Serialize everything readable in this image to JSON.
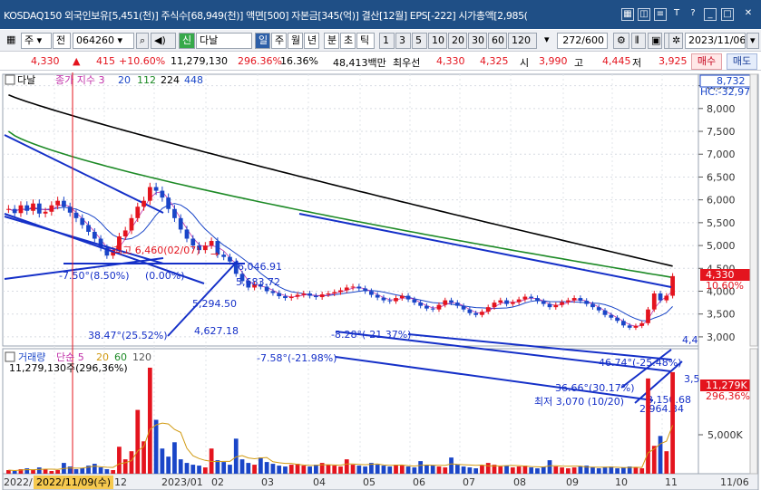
{
  "window": {
    "title": "KOSDAQ150 외국인보유[5,451(천)] 주식수[68,949(천)] 액면[500] 자본금[345(억)] 결산[12월] EPS[-222] 시가총액[2,985(",
    "icons": [
      "grid-icon",
      "save-icon",
      "list-icon",
      "text-icon",
      "help-icon",
      "minimize-icon",
      "maximize-icon",
      "close-icon"
    ],
    "close_glyph": "✕",
    "help_glyph": "?",
    "text_glyph": "T"
  },
  "toolbar": {
    "market_type": "주",
    "code_prefix": "전",
    "stock_code": "064260",
    "stock_badge": "신",
    "stock_name": "다날",
    "periods": [
      "일",
      "주",
      "월",
      "년",
      "분",
      "초",
      "틱"
    ],
    "minute_intervals": [
      "1",
      "3",
      "5",
      "10",
      "20",
      "30",
      "60",
      "120"
    ],
    "display_count": "272",
    "display_total": "/600",
    "date": "2023/11/06"
  },
  "quote": {
    "price": "4,330",
    "change": "415",
    "change_pct": "+10.60%",
    "volume": "11,279,130",
    "volume_ratio": "296.36%",
    "turnover": "16.36%",
    "amount": "48,413백만",
    "best_ask_label": "최우선",
    "best_ask": "4,330",
    "best_bid": "4,325",
    "open_label": "시",
    "open": "3,990",
    "high_label": "고",
    "high": "4,445",
    "low_label": "저",
    "low": "3,925",
    "buy_label": "매수",
    "sell_label": "매도"
  },
  "chart_data": [
    {
      "type": "candlestick",
      "series": [
        {
          "name": "다날",
          "kind": "candle"
        },
        {
          "name": "종가 지수",
          "value": "3"
        },
        {
          "name": "20",
          "color": "#1a46c8"
        },
        {
          "name": "112",
          "color": "#1d8a26"
        },
        {
          "name": "224",
          "color": "#000000"
        },
        {
          "name": "448",
          "color": "#1a46c8"
        }
      ],
      "legend_text": {
        "name": "다날",
        "ma_label": "종가 지수 3",
        "periods": [
          "20",
          "112",
          "224",
          "448"
        ]
      },
      "hc_label": "HC:-32,97",
      "current_price_label": "8,732",
      "ylim": [
        2800,
        8750
      ],
      "yticks": [
        3000,
        3500,
        4000,
        4500,
        5000,
        5500,
        6000,
        6500,
        7000,
        7500,
        8000,
        8500
      ],
      "ytick_labels": [
        "3,000",
        "3,500",
        "4,000",
        "4,500",
        "5,000",
        "5,500",
        "6,000",
        "6,500",
        "7,000",
        "7,500",
        "8,000",
        "8,500"
      ],
      "price_tag": "4,330",
      "pct_tag": "10.60%",
      "close": [
        5800,
        5710,
        5880,
        5760,
        5920,
        5700,
        5740,
        5880,
        5980,
        5850,
        5720,
        5600,
        5450,
        5300,
        5150,
        4950,
        4780,
        4900,
        5200,
        5330,
        5600,
        5850,
        5980,
        6280,
        6200,
        6050,
        5800,
        5600,
        5350,
        5150,
        5000,
        4900,
        5000,
        5100,
        4800,
        4750,
        4650,
        4380,
        4220,
        4080,
        4150,
        4100,
        4000,
        3960,
        3890,
        3850,
        3880,
        3920,
        3950,
        3900,
        3870,
        3930,
        3950,
        3980,
        4020,
        4080,
        4100,
        4060,
        4000,
        3920,
        3860,
        3800,
        3780,
        3850,
        3900,
        3820,
        3750,
        3680,
        3620,
        3600,
        3700,
        3800,
        3750,
        3680,
        3600,
        3520,
        3480,
        3550,
        3650,
        3750,
        3800,
        3720,
        3760,
        3820,
        3880,
        3850,
        3780,
        3720,
        3650,
        3700,
        3760,
        3800,
        3850,
        3790,
        3720,
        3650,
        3580,
        3480,
        3420,
        3350,
        3250,
        3200,
        3240,
        3300,
        3600,
        3950,
        3800,
        3900,
        4330
      ],
      "annotations": [
        "최고 6,460(02/07)",
        "6,046.91",
        "5,683.72",
        "5,294.50",
        "4,627.18",
        "38.47°(25.52%)",
        "-7.50°(8.50%)",
        "(0.00%)",
        "-7.58°(-21.98%)",
        "-8.28°(-21.37%)",
        "46.74°(-25.48%)",
        "36.66°(30.17%)",
        "최저 3,070 (10/20)",
        "3,150.68",
        "2,964.34",
        "4,4",
        "3,5"
      ],
      "annotation_values": {
        "high": "6,460",
        "low": "3,070"
      }
    },
    {
      "type": "bar",
      "title": "거래량",
      "ma_label": "단순 5",
      "ma_periods": [
        "20",
        "60",
        "120"
      ],
      "summary": "11,279,130주(296,36%)",
      "ytick_labels": [
        "5,000K"
      ],
      "tag_volume": "11,279K",
      "tag_pct": "296,36%",
      "values": [
        0.4,
        0.3,
        0.5,
        0.6,
        0.4,
        0.7,
        0.5,
        0.3,
        0.4,
        1.2,
        0.8,
        0.5,
        0.6,
        0.9,
        1.1,
        0.7,
        0.5,
        0.4,
        3.0,
        1.6,
        2.5,
        7.1,
        3.6,
        11.8,
        6.0,
        2.8,
        1.9,
        3.5,
        1.6,
        1.2,
        1.0,
        0.9,
        0.7,
        2.8,
        1.5,
        1.3,
        1.0,
        3.9,
        1.6,
        1.2,
        1.0,
        1.8,
        1.3,
        1.1,
        0.9,
        0.8,
        1.0,
        1.1,
        0.9,
        0.8,
        1.0,
        1.2,
        1.0,
        0.9,
        0.8,
        1.6,
        1.0,
        0.9,
        0.8,
        1.2,
        1.0,
        0.9,
        0.8,
        1.0,
        0.9,
        0.8,
        0.7,
        1.4,
        1.0,
        0.9,
        0.8,
        0.7,
        1.8,
        1.0,
        0.8,
        0.7,
        0.6,
        0.9,
        1.2,
        1.0,
        0.8,
        0.9,
        0.7,
        0.8,
        0.9,
        0.7,
        0.6,
        0.8,
        1.5,
        0.8,
        0.7,
        0.6,
        0.7,
        0.8,
        0.9,
        0.7,
        0.6,
        0.7,
        0.8,
        0.6,
        0.7,
        0.8,
        0.7,
        0.6,
        10.6,
        3.1,
        4.2,
        2.5,
        11.3
      ]
    }
  ],
  "x_axis": {
    "labels": [
      "2022/",
      "2022/11/09(수)",
      "12",
      "2023/01",
      "02",
      "03",
      "04",
      "05",
      "06",
      "07",
      "08",
      "09",
      "10",
      "11",
      "11/06"
    ],
    "cursor_date": "2022/11/09(수)"
  }
}
